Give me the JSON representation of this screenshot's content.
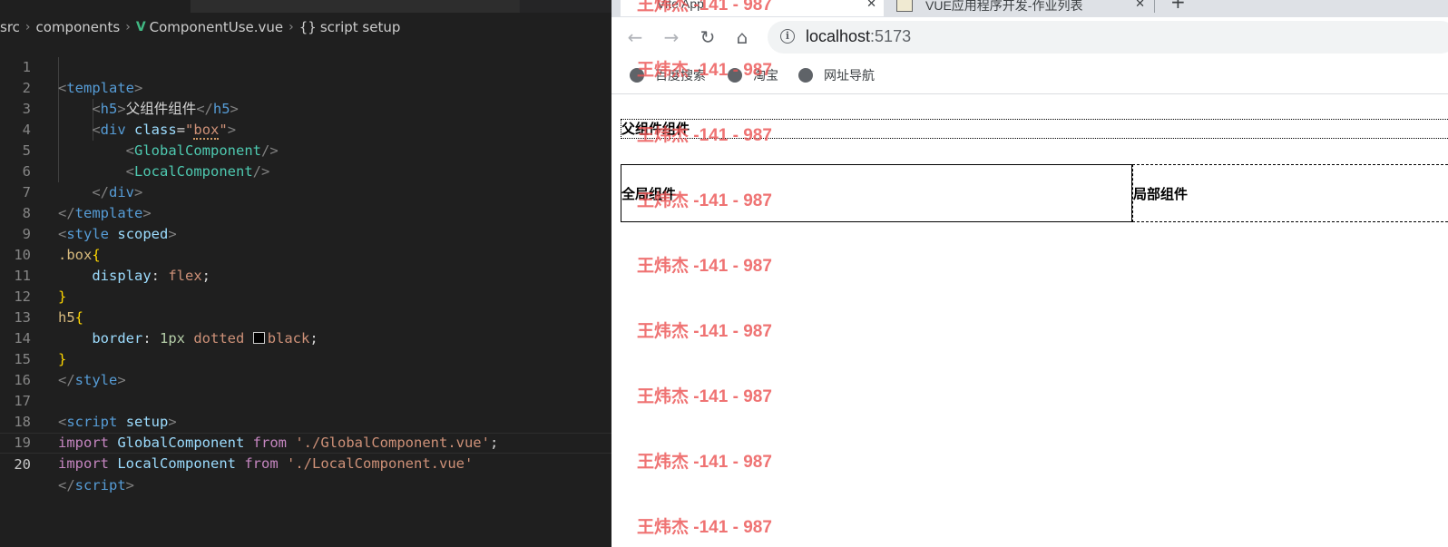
{
  "editor": {
    "breadcrumb": {
      "folder1": "src",
      "folder2": "components",
      "file": "ComponentUse.vue",
      "symbol": "script setup"
    },
    "line_numbers": [
      "1",
      "2",
      "3",
      "4",
      "5",
      "6",
      "7",
      "8",
      "9",
      "10",
      "11",
      "12",
      "13",
      "14",
      "15",
      "16",
      "17",
      "18",
      "19",
      "20"
    ],
    "code": {
      "l1_tag": "template",
      "l2_tag_open": "h5",
      "l2_text": "父组件组件",
      "l2_tag_close": "h5",
      "l3_tag": "div",
      "l3_attr": "class",
      "l3_value": "box",
      "l4_comp": "GlobalComponent",
      "l5_comp": "LocalComponent",
      "l6_tag": "div",
      "l7_tag": "template",
      "l8_tag": "style",
      "l8_attr": "scoped",
      "l9_selector": ".box",
      "l10_prop": "display",
      "l10_value": "flex",
      "l12_selector": "h5",
      "l13_prop": "border",
      "l13_num": "1px",
      "l13_style": "dotted",
      "l13_color": "black",
      "l15_tag": "style",
      "l17_tag": "script",
      "l17_attr": "setup",
      "kw_import": "import",
      "kw_from": "from",
      "l18_id": "GlobalComponent",
      "l18_path": "'./GlobalComponent.vue'",
      "l19_id": "LocalComponent",
      "l19_path": "'./LocalComponent.vue'",
      "l20_tag": "script"
    }
  },
  "browser": {
    "tabs": [
      {
        "title": "Vite App"
      },
      {
        "title": "VUE应用程序开发-作业列表"
      }
    ],
    "address": {
      "host": "localhost",
      "port": ":5173"
    },
    "bookmarks": [
      "百度搜索",
      "淘宝",
      "网址导航"
    ],
    "page": {
      "h5": "父组件组件",
      "global": "全局组件",
      "local": "局部组件"
    },
    "watermark": "王炜杰 -141 - 987"
  },
  "colors": {
    "editor_bg": "#1f1f1f",
    "tag": "#569cd6",
    "component": "#4ec9b0",
    "string": "#ce9178",
    "keyword": "#c586c0",
    "watermark": "#ec5454"
  }
}
